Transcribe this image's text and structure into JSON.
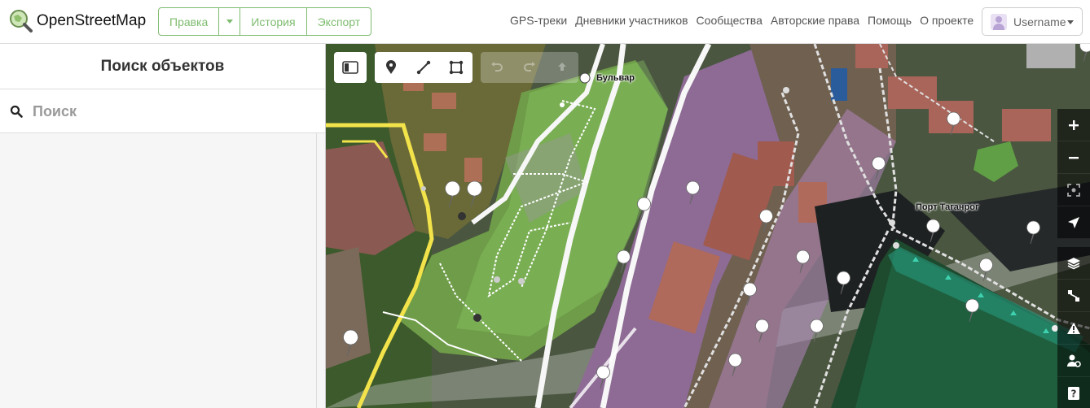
{
  "header": {
    "brand": "OpenStreetMap",
    "edit_label": "Правка",
    "history_label": "История",
    "export_label": "Экспорт",
    "nav": [
      "GPS-треки",
      "Дневники участников",
      "Сообщества",
      "Авторские права",
      "Помощь",
      "О проекте"
    ],
    "username": "Username"
  },
  "sidebar": {
    "title": "Поиск объектов",
    "search_placeholder": "Поиск"
  },
  "map": {
    "labels": {
      "bulvar": "Бульвар",
      "port": "Порт Таганрог"
    },
    "colors": {
      "accent": "#7ebc6f",
      "park": "#8ed06a",
      "industrial": "#c79fd6",
      "water_port": "#27a38a",
      "road_main": "#f7f7f7",
      "road_yellow": "#f3e34b"
    }
  }
}
